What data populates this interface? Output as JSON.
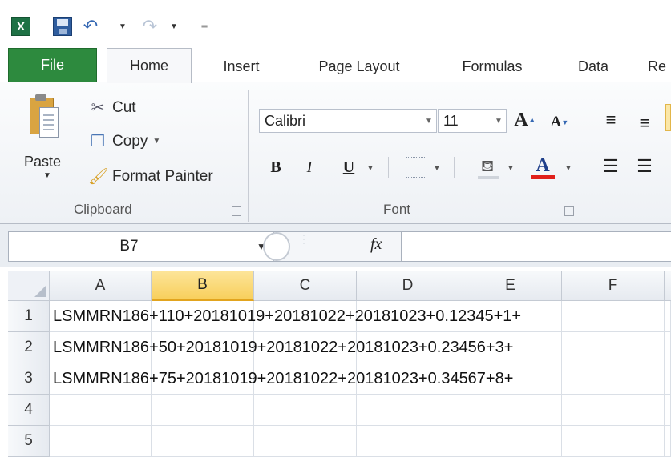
{
  "qat": {
    "app_icon": "excel-icon",
    "save_icon": "save-icon",
    "undo_icon": "undo-icon",
    "redo_icon": "redo-icon",
    "customize_icon": "customize-qat-icon"
  },
  "tabs": [
    {
      "label": "File"
    },
    {
      "label": "Home"
    },
    {
      "label": "Insert"
    },
    {
      "label": "Page Layout"
    },
    {
      "label": "Formulas"
    },
    {
      "label": "Data"
    },
    {
      "label": "Re"
    }
  ],
  "clipboard": {
    "paste_label": "Paste",
    "cut_label": "Cut",
    "copy_label": "Copy",
    "format_painter_label": "Format Painter",
    "group_label": "Clipboard"
  },
  "font": {
    "font_name": "Calibri",
    "font_size": "11",
    "grow_label": "A",
    "shrink_label": "A",
    "bold_label": "B",
    "italic_label": "I",
    "underline_label": "U",
    "font_color_label": "A",
    "group_label": "Font"
  },
  "formula_bar": {
    "name_box": "B7",
    "fx_label": "fx",
    "formula": ""
  },
  "grid": {
    "columns": [
      "A",
      "B",
      "C",
      "D",
      "E",
      "F"
    ],
    "selected_column": "B",
    "rows": [
      "1",
      "2",
      "3",
      "4",
      "5"
    ],
    "cells": [
      "LSMMRN186+110+20181019+20181022+20181023+0.12345+1+",
      "LSMMRN186+50+20181019+20181022+20181023+0.23456+3+",
      "LSMMRN186+75+20181019+20181022+20181023+0.34567+8+",
      "",
      ""
    ]
  },
  "colors": {
    "file_tab": "#2d8a3e",
    "selected_header": "#f8cf5c",
    "font_color_bar": "#e0201b"
  }
}
